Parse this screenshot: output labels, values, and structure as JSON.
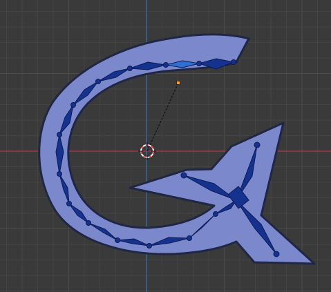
{
  "colors": {
    "background": "#3a3a3a",
    "grid_minor": "#444444",
    "grid_major": "#4c4c4c",
    "axis_x": "#9b3a47",
    "axis_y": "#3b6aa0",
    "mesh_fill": "#7c88cc",
    "mesh_outline": "#1f2744",
    "bone_fill": "#15328f",
    "bone_outline": "#0a1a55",
    "bone_selected": "#2f6fd2",
    "origin_ring": "#e35454",
    "handle": "#ff9a2e"
  },
  "icons": {
    "cursor": "3d-cursor-icon",
    "handle": "ik-target-handle-icon"
  }
}
